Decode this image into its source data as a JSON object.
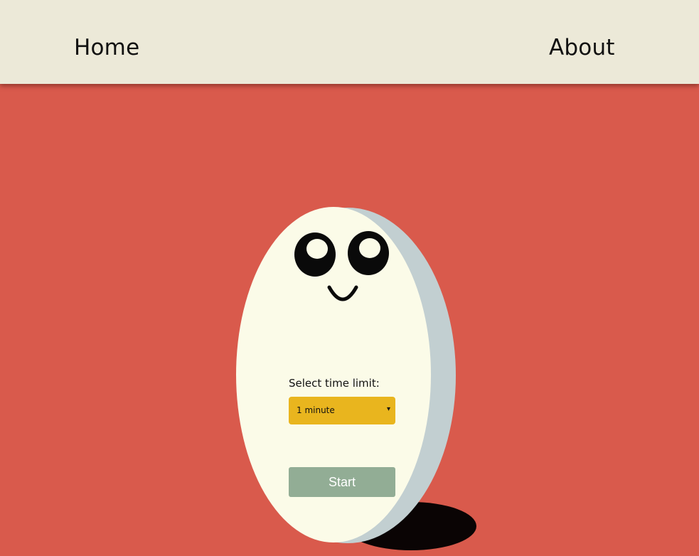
{
  "nav": {
    "home_label": "Home",
    "about_label": "About"
  },
  "timer": {
    "label": "Select time limit:",
    "selected_value": "1 minute",
    "arrow_glyph": "▾"
  },
  "actions": {
    "start_label": "Start"
  },
  "colors": {
    "background": "#d95a4c",
    "navbar": "#ece9d8",
    "egg_face": "#fbfbe8",
    "egg_side": "#c2cfd1",
    "select_bg": "#e9b51e",
    "start_bg": "#92ad95"
  }
}
